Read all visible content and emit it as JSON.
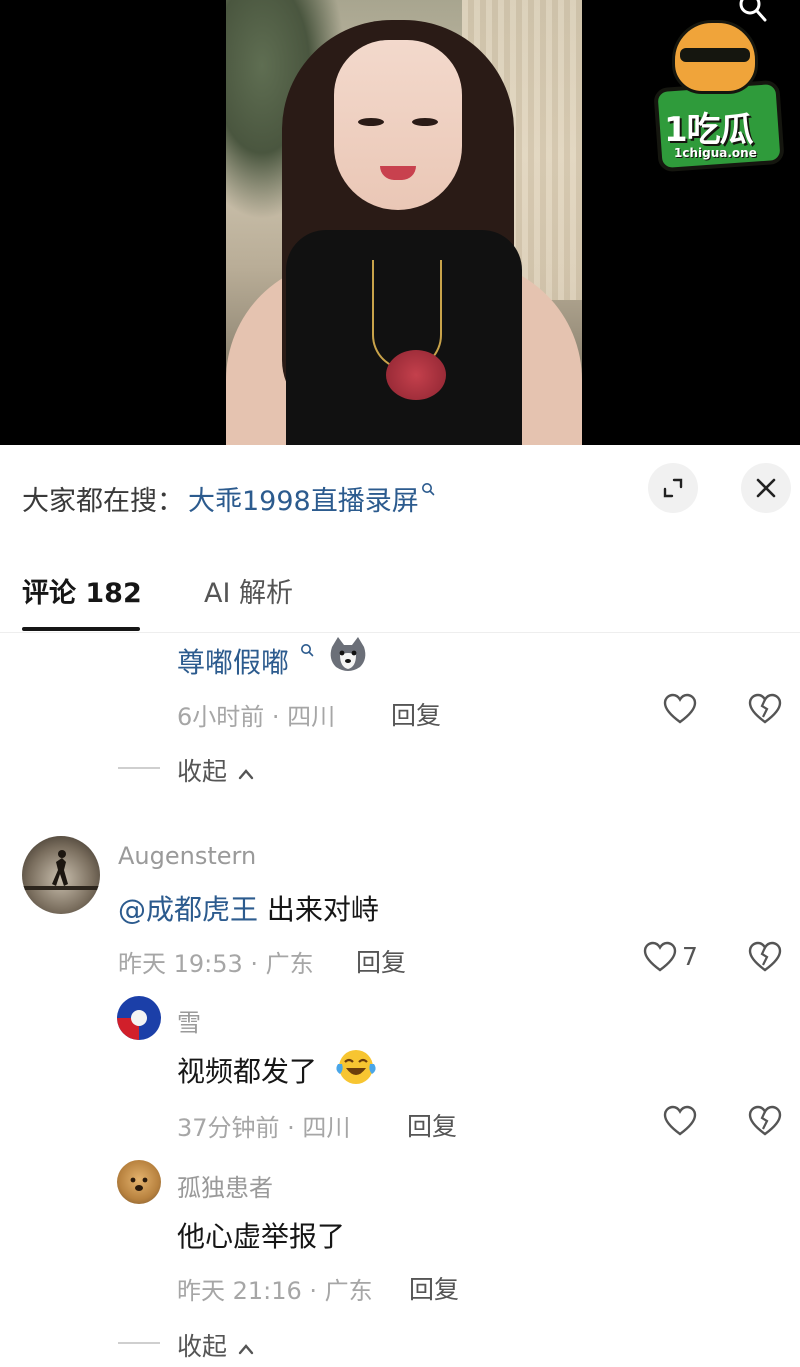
{
  "logo": {
    "brand": "1吃瓜",
    "domain": "1chigua.one",
    "icon": "watermelon-dog-mascot"
  },
  "search_suggestion": {
    "label": "大家都在搜：",
    "keyword": "大乖1998直播录屏",
    "icon": "search-icon"
  },
  "sheet_buttons": {
    "expand_icon": "expand-icon",
    "close_icon": "close-icon"
  },
  "tabs": [
    {
      "label": "评论 182",
      "active": true
    },
    {
      "label": "AI 解析",
      "active": false
    }
  ],
  "comments": {
    "partial_reply": {
      "text": "尊嘟假嘟",
      "emoji": "husky-emoji",
      "meta": "6小时前 · 四川",
      "reply_label": "回复"
    },
    "collapse_1": {
      "label": "收起"
    },
    "main": {
      "username": "Augenstern",
      "mention": "@成都虎王",
      "text": "出来对峙",
      "meta": "昨天 19:53 · 广东",
      "reply_label": "回复",
      "like_count": "7"
    },
    "reply_1": {
      "username": "雪",
      "text": "视频都发了",
      "emoji": "laughing-crying-emoji",
      "meta": "37分钟前 · 四川",
      "reply_label": "回复"
    },
    "reply_2": {
      "username": "孤独患者",
      "text": "他心虚举报了",
      "meta": "昨天 21:16 · 广东",
      "reply_label": "回复"
    },
    "collapse_2": {
      "label": "收起"
    }
  },
  "colors": {
    "link_blue": "#2c5b8e",
    "muted": "#a6a6a6",
    "background": "#ffffff"
  }
}
